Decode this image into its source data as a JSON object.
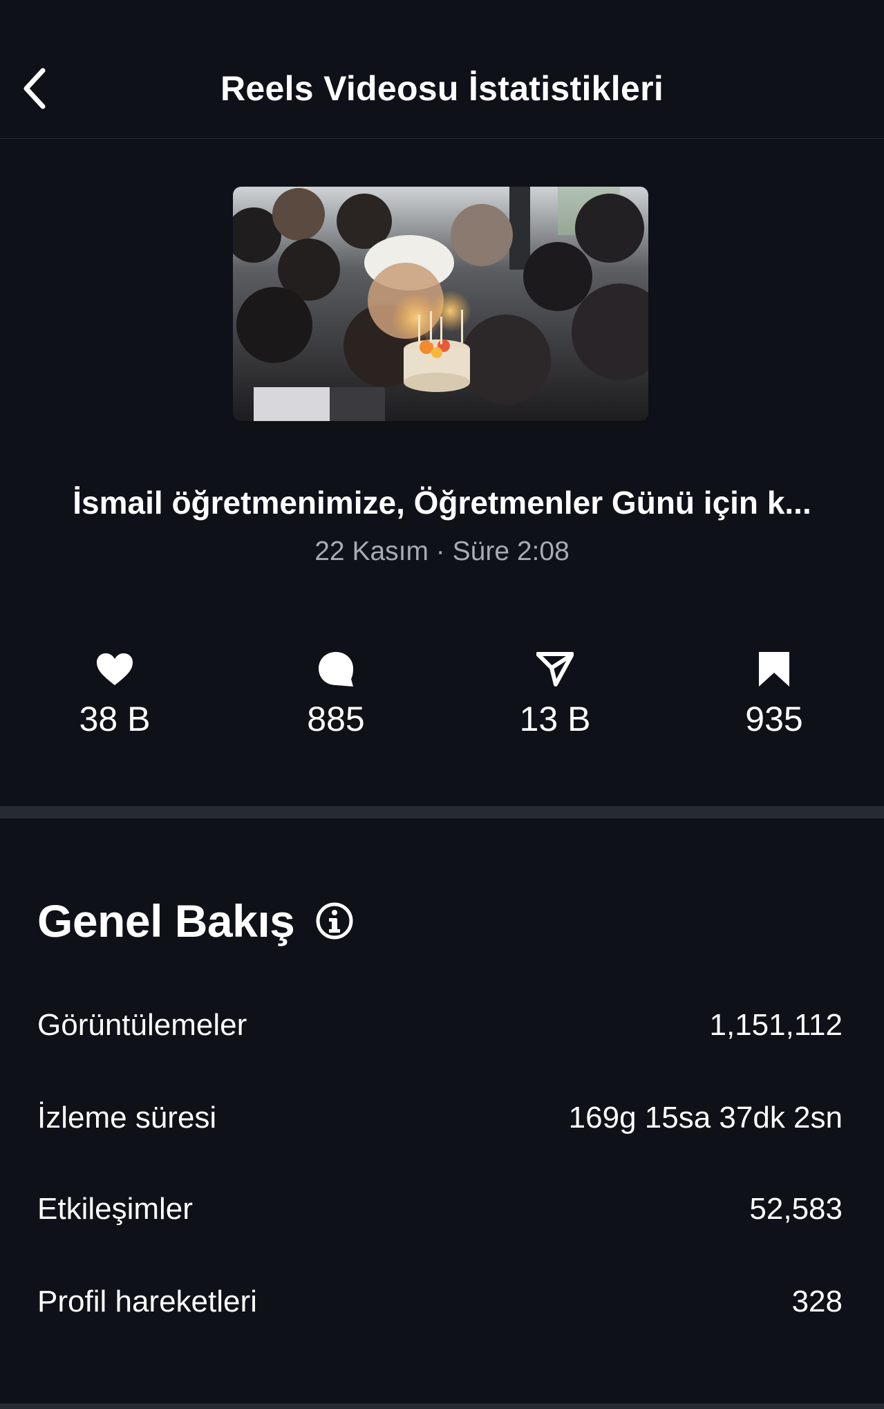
{
  "header": {
    "title": "Reels Videosu İstatistikleri",
    "back_icon": "chevron-left-icon"
  },
  "video": {
    "thumbnail_icon": "video-thumbnail",
    "caption": "İsmail öğretmenimize, Öğretmenler Günü için k...",
    "meta": "22 Kasım · Süre 2:08"
  },
  "stats": {
    "likes": {
      "icon": "heart-icon",
      "value": "38 B"
    },
    "comments": {
      "icon": "comment-icon",
      "value": "885"
    },
    "shares": {
      "icon": "share-icon",
      "value": "13 B"
    },
    "saves": {
      "icon": "bookmark-icon",
      "value": "935"
    }
  },
  "overview": {
    "title": "Genel Bakış",
    "info_icon": "info-icon",
    "rows": [
      {
        "label": "Görüntülemeler",
        "value": "1,151,112"
      },
      {
        "label": "İzleme süresi",
        "value": "169g 15sa 37dk 2sn"
      },
      {
        "label": "Etkileşimler",
        "value": "52,583"
      },
      {
        "label": "Profil hareketleri",
        "value": "328"
      }
    ]
  },
  "colors": {
    "background": "#0e1118",
    "divider": "#262a31",
    "text_primary": "#ffffff",
    "text_secondary": "#a7abb3"
  }
}
